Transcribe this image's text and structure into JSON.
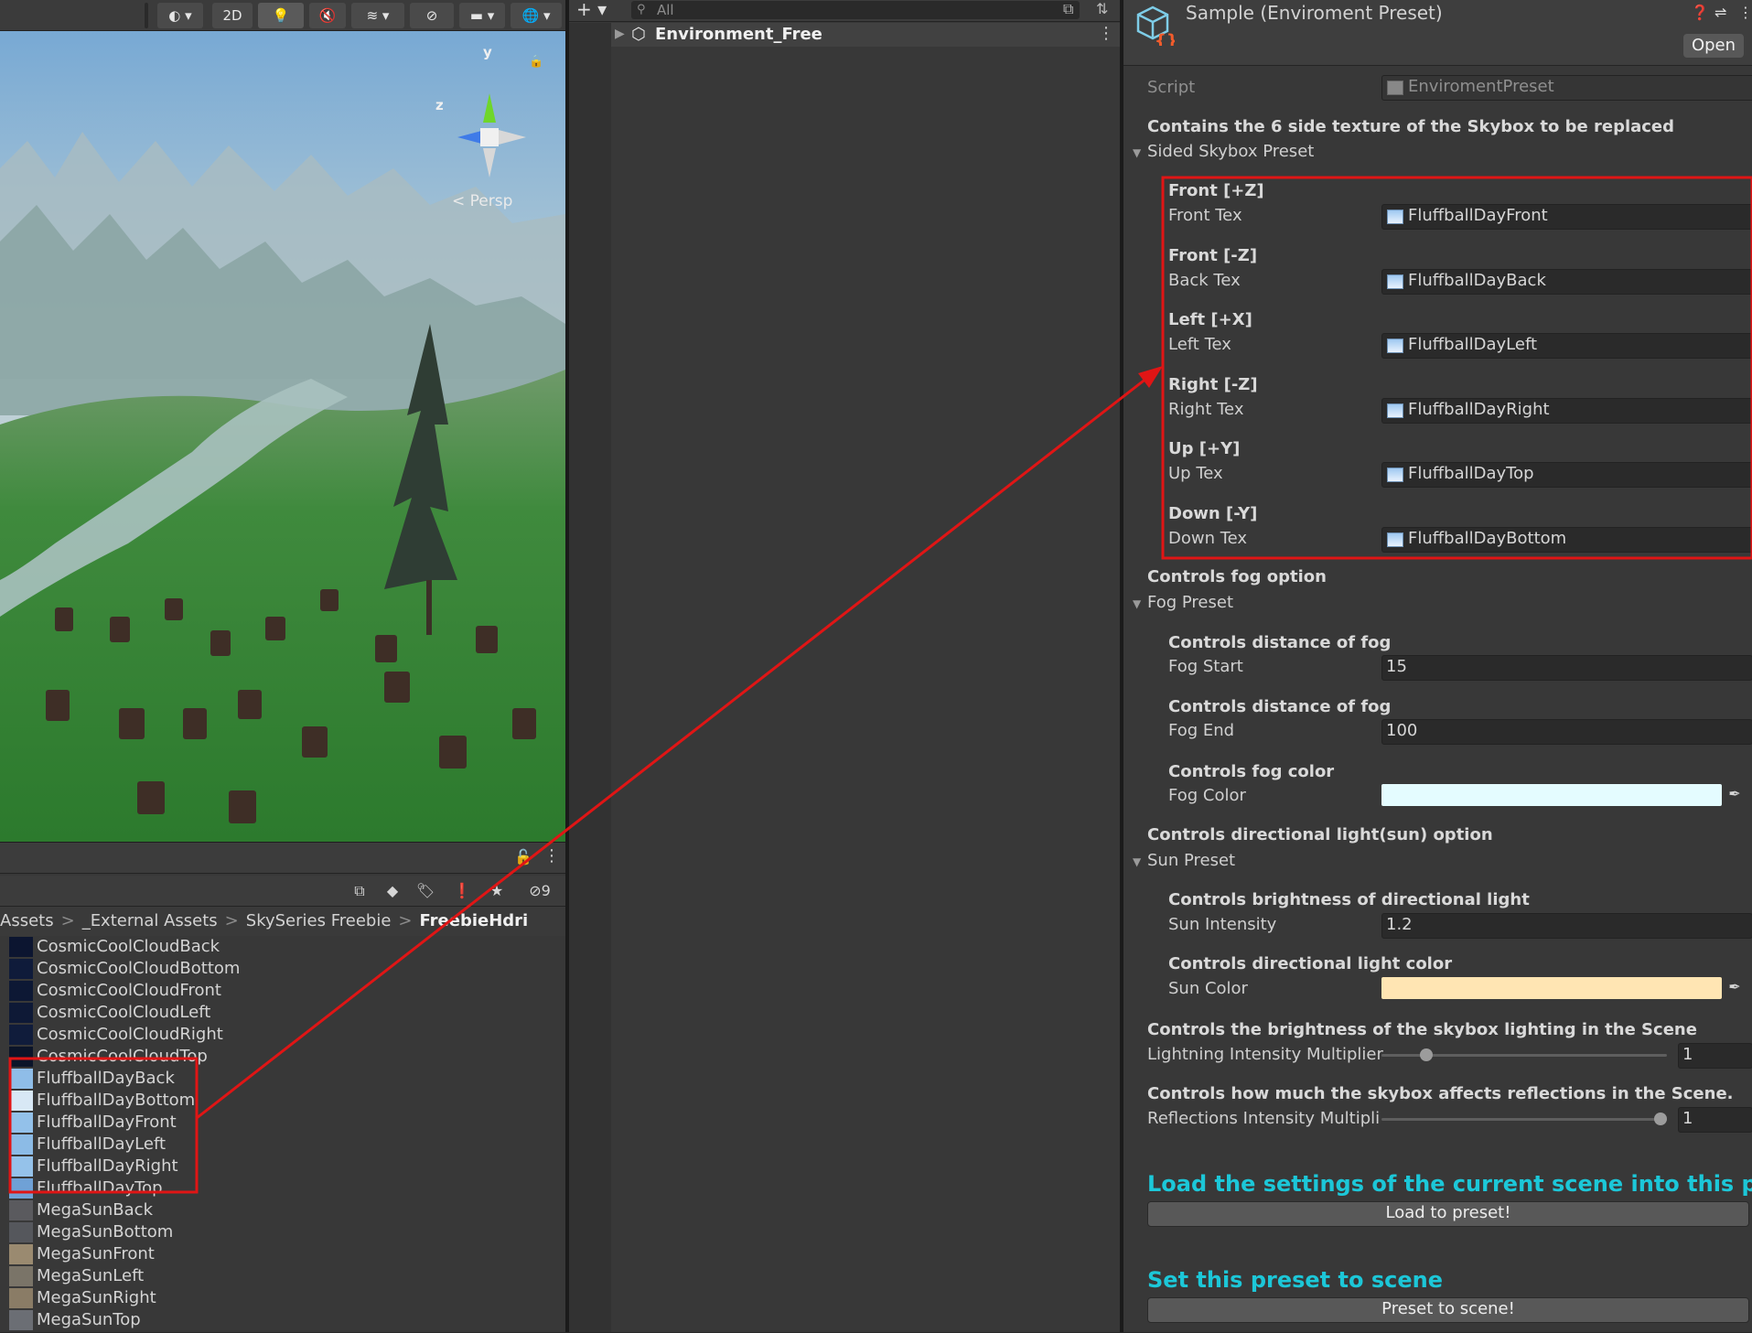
{
  "scene": {
    "toolbar": {
      "mode_2d": "2D",
      "persp_label": "Persp"
    },
    "gizmo": {
      "y_label": "y",
      "z_label": "z"
    }
  },
  "project": {
    "hidden_count": "9",
    "breadcrumb": [
      "Assets",
      "_External Assets",
      "SkySeries Freebie",
      "FreebieHdri"
    ],
    "assets": [
      {
        "name": "CosmicCoolCloudBack",
        "thumb": "#0c1530"
      },
      {
        "name": "CosmicCoolCloudBottom",
        "thumb": "#0f1b3a"
      },
      {
        "name": "CosmicCoolCloudFront",
        "thumb": "#0d1834"
      },
      {
        "name": "CosmicCoolCloudLeft",
        "thumb": "#0e1936"
      },
      {
        "name": "CosmicCoolCloudRight",
        "thumb": "#101c3b"
      },
      {
        "name": "CosmicCoolCloudTop",
        "thumb": "#0b1429"
      },
      {
        "name": "FluffballDayBack",
        "thumb": "#8fbde8"
      },
      {
        "name": "FluffballDayBottom",
        "thumb": "#d8e8f5"
      },
      {
        "name": "FluffballDayFront",
        "thumb": "#93c1ea"
      },
      {
        "name": "FluffballDayLeft",
        "thumb": "#8cbbe6"
      },
      {
        "name": "FluffballDayRight",
        "thumb": "#95c2ea"
      },
      {
        "name": "FluffballDayTop",
        "thumb": "#6fa1d6"
      },
      {
        "name": "MegaSunBack",
        "thumb": "#5a5a5e"
      },
      {
        "name": "MegaSunBottom",
        "thumb": "#55575c"
      },
      {
        "name": "MegaSunFront",
        "thumb": "#9a8a70"
      },
      {
        "name": "MegaSunLeft",
        "thumb": "#7a7468"
      },
      {
        "name": "MegaSunRight",
        "thumb": "#8a7c66"
      },
      {
        "name": "MegaSunTop",
        "thumb": "#6b6e74"
      }
    ]
  },
  "hierarchy": {
    "search_placeholder": "All",
    "root_object": "Environment_Free"
  },
  "inspector": {
    "title": "Sample (Enviroment Preset)",
    "open_label": "Open",
    "script_label": "Script",
    "script_value": "EnviromentPreset",
    "skybox_desc": "Contains the 6 side texture of the Skybox to be replaced",
    "skybox_foldout": "Sided Skybox Preset",
    "skybox_fields": [
      {
        "header": "Front [+Z]",
        "label": "Front Tex",
        "value": "FluffballDayFront"
      },
      {
        "header": "Front [-Z]",
        "label": "Back Tex",
        "value": "FluffballDayBack"
      },
      {
        "header": "Left [+X]",
        "label": "Left Tex",
        "value": "FluffballDayLeft"
      },
      {
        "header": "Right [-Z]",
        "label": "Right Tex",
        "value": "FluffballDayRight"
      },
      {
        "header": "Up [+Y]",
        "label": "Up Tex",
        "value": "FluffballDayTop"
      },
      {
        "header": "Down [-Y]",
        "label": "Down Tex",
        "value": "FluffballDayBottom"
      }
    ],
    "fog_desc": "Controls fog option",
    "fog_foldout": "Fog Preset",
    "fog_start_header": "Controls distance of fog",
    "fog_start_label": "Fog Start",
    "fog_start_value": "15",
    "fog_end_header": "Controls distance of fog",
    "fog_end_label": "Fog End",
    "fog_end_value": "100",
    "fog_color_header": "Controls fog color",
    "fog_color_label": "Fog Color",
    "fog_color": "#e4fcff",
    "sun_desc": "Controls directional light(sun) option",
    "sun_foldout": "Sun Preset",
    "sun_intensity_header": "Controls brightness of directional light",
    "sun_intensity_label": "Sun Intensity",
    "sun_intensity_value": "1.2",
    "sun_color_header": "Controls directional light color",
    "sun_color_label": "Sun Color",
    "sun_color": "#ffe5b3",
    "lighting_desc": "Controls the brightness of the skybox lighting in the Scene",
    "lighting_label": "Lightning Intensity Multiplier",
    "lighting_value": "1",
    "lighting_fraction": 0.14,
    "reflections_desc": "Controls how much the skybox affects reflections in the Scene.",
    "reflections_label": "Reflections Intensity Multipli",
    "reflections_value": "1",
    "reflections_fraction": 1.0,
    "load_title": "Load the settings of the current scene into this preset",
    "load_button": "Load to preset!",
    "set_title": "Set this preset to scene",
    "set_button": "Preset to scene!"
  },
  "colors": {
    "accent_cyan": "#1cc7d8",
    "highlight_red": "#e01515"
  }
}
